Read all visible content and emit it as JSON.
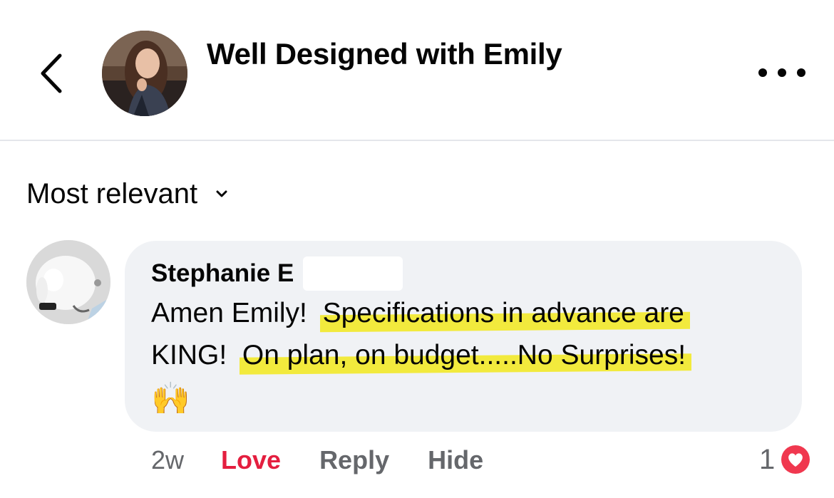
{
  "header": {
    "back_icon": "chevron-left-icon",
    "title": "Well Designed with Emily",
    "more_icon": "ellipsis-icon"
  },
  "sort": {
    "label": "Most relevant",
    "icon": "chevron-down-icon"
  },
  "comment": {
    "author": "Stephanie E",
    "line1_plain": "Amen Emily!  ",
    "line1_highlight": "Specifications in advance are",
    "line2_plain": "KING!  ",
    "line2_highlight": "On plan, on budget.....No Surprises!",
    "emoji": "🙌",
    "time": "2w",
    "actions": {
      "love": "Love",
      "reply": "Reply",
      "hide": "Hide"
    },
    "reaction_count": "1",
    "reaction_icon": "heart-icon"
  },
  "colors": {
    "love": "#e41e3f",
    "highlight": "#f2ea3d",
    "bubble": "#f0f2f5",
    "meta": "#65676b"
  }
}
